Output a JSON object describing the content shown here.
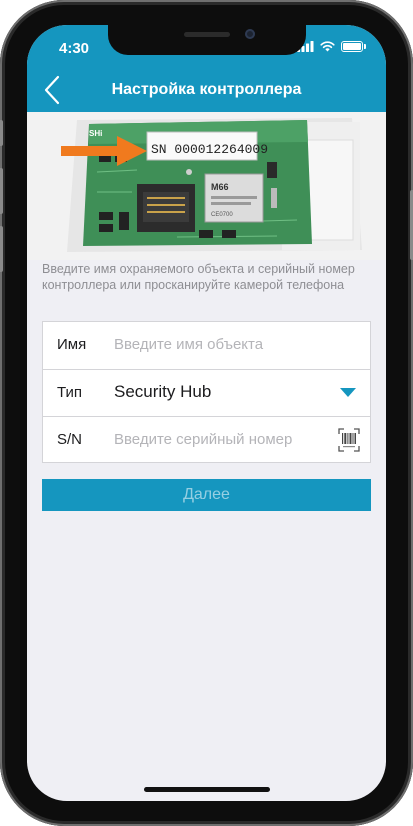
{
  "status_bar": {
    "time": "4:30"
  },
  "nav": {
    "title": "Настройка контроллера",
    "back_icon": "chevron-left-icon"
  },
  "photo": {
    "serial_label": "SN 000012264009",
    "module_label": "M66",
    "vendor_text": "SHi",
    "certification": "CE0700"
  },
  "instruction": "Введите имя охраняемого объекта и серийный номер контроллера или просканируйте камерой телефона",
  "form": {
    "name_label": "Имя",
    "name_placeholder": "Введите имя объекта",
    "type_label": "Тип",
    "type_value": "Security Hub",
    "sn_label": "S/N",
    "sn_placeholder": "Введите серийный номер"
  },
  "next_button": "Далее",
  "colors": {
    "accent": "#1596bf",
    "arrow": "#f07a1e"
  }
}
